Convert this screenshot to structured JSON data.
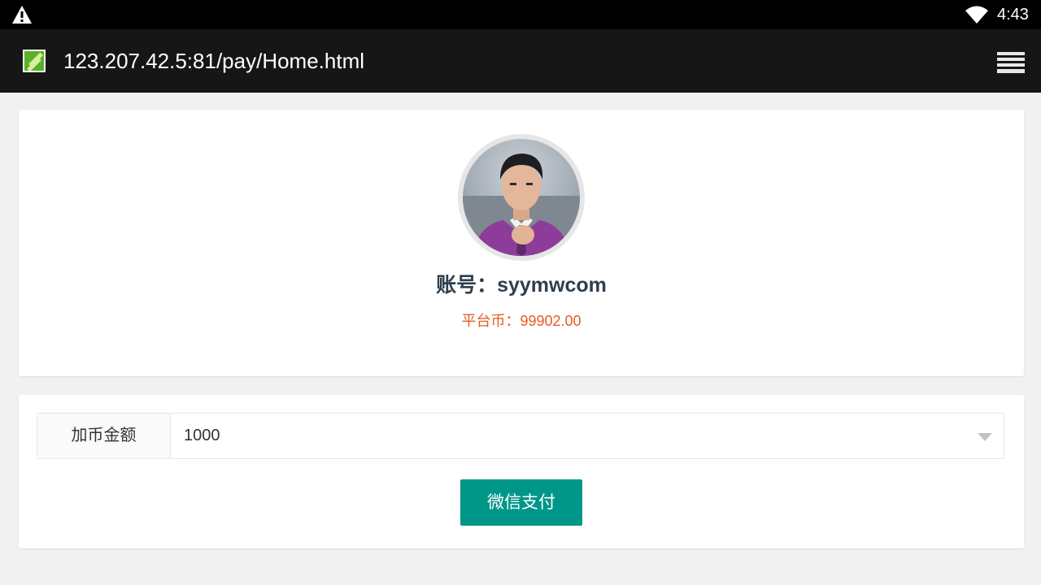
{
  "status_bar": {
    "time": "4:43",
    "left_icon": "warning-icon",
    "wifi_icon": "wifi-icon"
  },
  "browser": {
    "url": "123.207.42.5:81/pay/Home.html",
    "favicon": "site-favicon",
    "menu_icon": "tabs-menu-icon"
  },
  "profile": {
    "avatar": "user-avatar",
    "account_text": "账号：syymwcom",
    "coin_text": "平台币：99902.00"
  },
  "payment": {
    "amount_label": "加币金额",
    "amount_value": "1000",
    "pay_button_label": "微信支付"
  },
  "colors": {
    "accent": "#009688",
    "coin": "#e85a24",
    "account_text": "#2f3e4d"
  }
}
